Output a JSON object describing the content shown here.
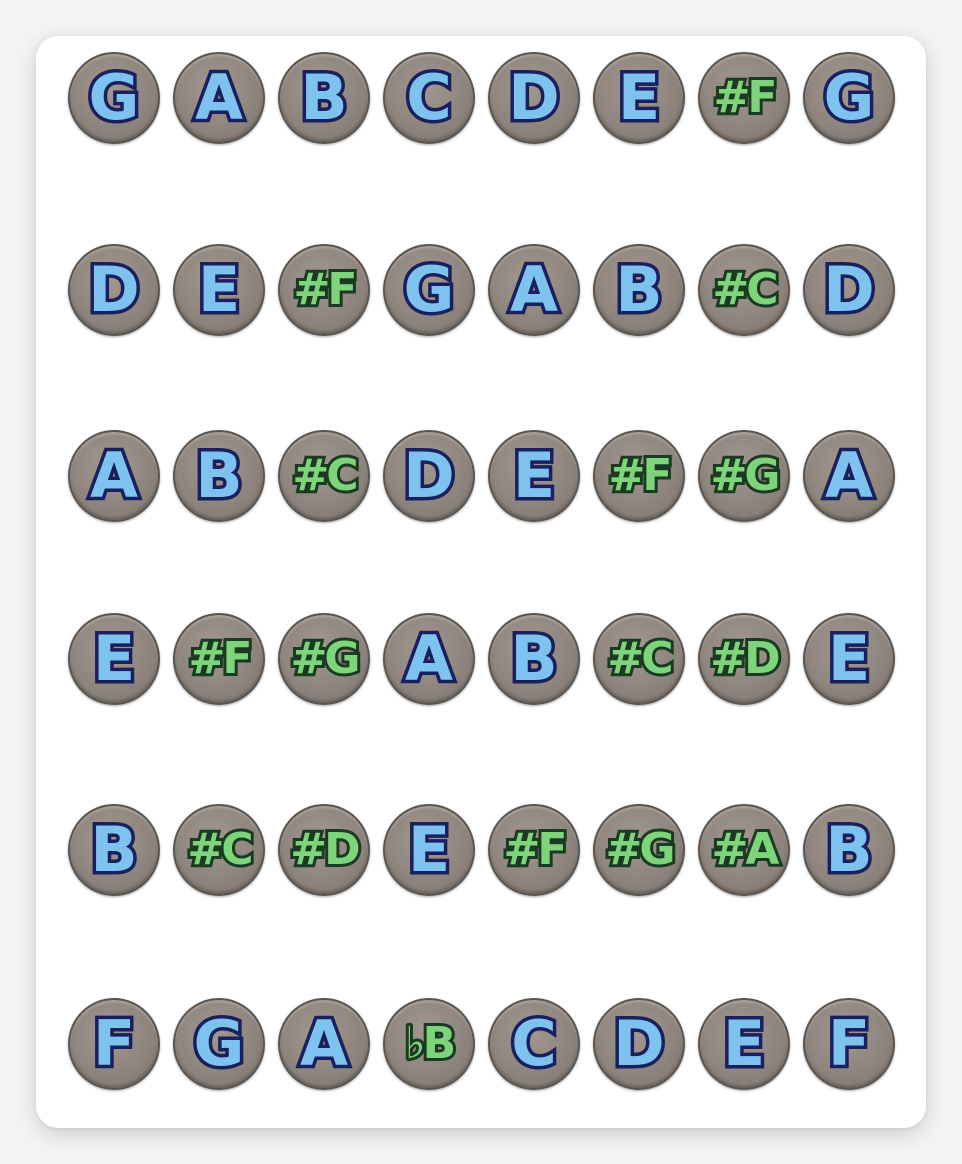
{
  "rows": [
    [
      "G",
      "A",
      "B",
      "C",
      "D",
      "E",
      "#F",
      "G"
    ],
    [
      "D",
      "E",
      "#F",
      "G",
      "A",
      "B",
      "#C",
      "D"
    ],
    [
      "A",
      "B",
      "#C",
      "D",
      "E",
      "#F",
      "#G",
      "A"
    ],
    [
      "E",
      "#F",
      "#G",
      "A",
      "B",
      "#C",
      "#D",
      "E"
    ],
    [
      "B",
      "#C",
      "#D",
      "E",
      "#F",
      "#G",
      "#A",
      "B"
    ],
    [
      "F",
      "G",
      "A",
      "♭B",
      "C",
      "D",
      "E",
      "F"
    ]
  ],
  "colors": {
    "natural_fill": "#7ec3ef",
    "accidental_fill": "#7ed47a",
    "outline": "#1a1f5e",
    "button": "#8d847d"
  }
}
